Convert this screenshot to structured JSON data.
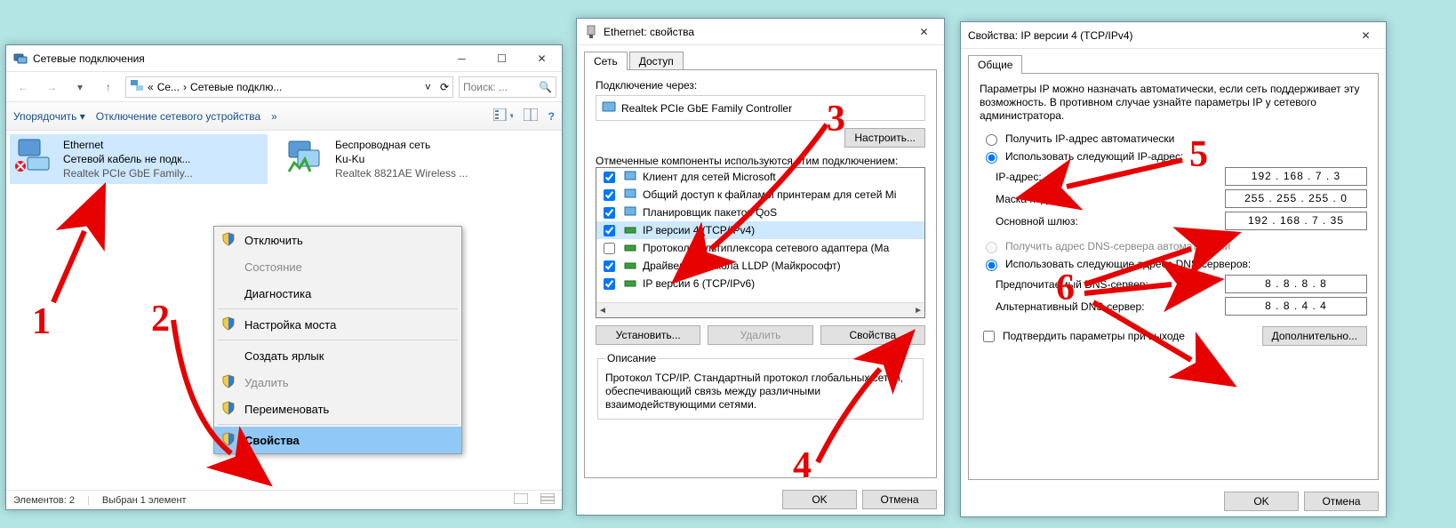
{
  "w1": {
    "title": "Сетевые подключения",
    "breadcrumb_parent": "Се...",
    "breadcrumb_current": "Сетевые подклю...",
    "search_placeholder": "Поиск: ...",
    "cmd_organize": "Упорядочить",
    "cmd_disable": "Отключение сетевого устройства",
    "conn1": {
      "name": "Ethernet",
      "state": "Сетевой кабель не подк...",
      "adapter": "Realtek PCIe GbE Family..."
    },
    "conn2": {
      "name": "Беспроводная сеть",
      "state": "Ku-Ku",
      "adapter": "Realtek 8821AE Wireless ..."
    },
    "status_count": "Элементов: 2",
    "status_sel": "Выбран 1 элемент"
  },
  "menu": {
    "disable": "Отключить",
    "status": "Состояние",
    "diag": "Диагностика",
    "bridge": "Настройка моста",
    "shortcut": "Создать ярлык",
    "delete": "Удалить",
    "rename": "Переименовать",
    "props": "Свойства"
  },
  "w2": {
    "title": "Ethernet: свойства",
    "tab_net": "Сеть",
    "tab_access": "Доступ",
    "conn_via_lbl": "Подключение через:",
    "adapter": "Realtek PCIe GbE Family Controller",
    "btn_configure": "Настроить...",
    "components_lbl": "Отмеченные компоненты используются этим подключением:",
    "items": [
      "Клиент для сетей Microsoft",
      "Общий доступ к файлам и принтерам для сетей Mi",
      "Планировщик пакетов QoS",
      "IP версии 4 (TCP/IPv4)",
      "Протокол мультиплексора сетевого адаптера (Ма",
      "Драйвер протокола LLDP (Майкрософт)",
      "IP версии 6 (TCP/IPv6)"
    ],
    "btn_install": "Установить...",
    "btn_remove": "Удалить",
    "btn_props": "Свойства",
    "desc_legend": "Описание",
    "desc_text": "Протокол TCP/IP. Стандартный протокол глобальных сетей, обеспечивающий связь между различными взаимодействующими сетями.",
    "btn_ok": "OK",
    "btn_cancel": "Отмена"
  },
  "w3": {
    "title": "Свойства: IP версии 4 (TCP/IPv4)",
    "tab_general": "Общие",
    "note": "Параметры IP можно назначать автоматически, если сеть поддерживает эту возможность. В противном случае узнайте параметры IP у сетевого администратора.",
    "r_auto_ip": "Получить IP-адрес автоматически",
    "r_manual_ip": "Использовать следующий IP-адрес:",
    "lbl_ip": "IP-адрес:",
    "lbl_mask": "Маска подсети:",
    "lbl_gw": "Основной шлюз:",
    "val_ip": "192 . 168 .  7  .  3",
    "val_mask": "255 . 255 . 255 .  0",
    "val_gw": "192 . 168 .  7  . 35",
    "r_auto_dns": "Получить адрес DNS-сервера автоматически",
    "r_manual_dns": "Использовать следующие адреса DNS-серверов:",
    "lbl_dns1": "Предпочитаемый DNS-сервер:",
    "lbl_dns2": "Альтернативный DNS-сервер:",
    "val_dns1": "8  .  8  .  8  .  8",
    "val_dns2": "8  .  8  .  4  .  4",
    "chk_validate": "Подтвердить параметры при выходе",
    "btn_advanced": "Дополнительно...",
    "btn_ok": "OK",
    "btn_cancel": "Отмена"
  },
  "ann": {
    "n1": "1",
    "n2": "2",
    "n3": "3",
    "n4": "4",
    "n5": "5",
    "n6": "6"
  }
}
